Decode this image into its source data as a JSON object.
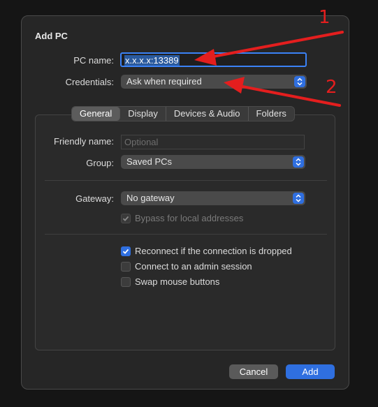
{
  "dialog": {
    "title": "Add PC",
    "pc_name_label": "PC name:",
    "pc_name_value": "x.x.x.x:13389",
    "credentials_label": "Credentials:",
    "credentials_value": "Ask when required",
    "tabs": [
      "General",
      "Display",
      "Devices & Audio",
      "Folders"
    ],
    "active_tab": "General",
    "friendly_label": "Friendly name:",
    "friendly_placeholder": "Optional",
    "group_label": "Group:",
    "group_value": "Saved PCs",
    "gateway_label": "Gateway:",
    "gateway_value": "No gateway",
    "bypass_label": "Bypass for local addresses",
    "bypass_checked": true,
    "reconnect_label": "Reconnect if the connection is dropped",
    "reconnect_checked": true,
    "admin_label": "Connect to an admin session",
    "admin_checked": false,
    "swap_label": "Swap mouse buttons",
    "swap_checked": false,
    "cancel_label": "Cancel",
    "add_label": "Add"
  },
  "annotations": {
    "marker_1": "1",
    "marker_2": "2",
    "arrow_color": "#e41e1e"
  },
  "colors": {
    "accent": "#2f6fe0",
    "background": "#262626"
  }
}
